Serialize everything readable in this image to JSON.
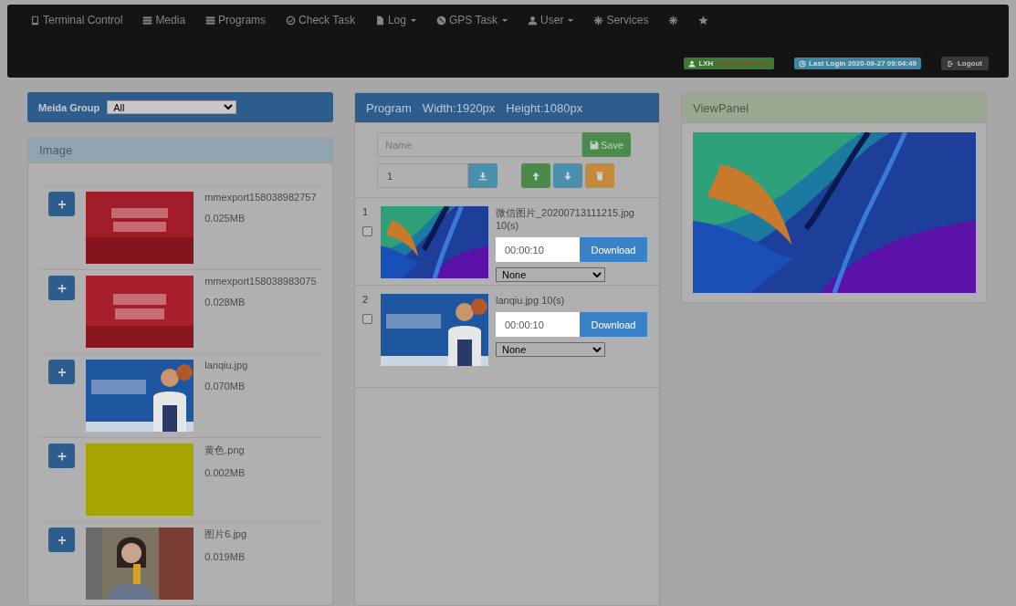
{
  "navbar": {
    "items": [
      {
        "kind": "phone",
        "label": "Terminal Control",
        "dropdown": false
      },
      {
        "kind": "list",
        "label": "Media",
        "dropdown": false
      },
      {
        "kind": "list",
        "label": "Programs",
        "dropdown": false
      },
      {
        "kind": "check",
        "label": "Check Task",
        "dropdown": false
      },
      {
        "kind": "file",
        "label": "Log",
        "dropdown": true
      },
      {
        "kind": "globe",
        "label": "GPS Task",
        "dropdown": true
      },
      {
        "kind": "user",
        "label": "User",
        "dropdown": true
      },
      {
        "kind": "asterisk",
        "label": "Services",
        "dropdown": false
      },
      {
        "kind": "asterisk",
        "dropdown": false
      },
      {
        "kind": "star",
        "dropdown": false
      }
    ],
    "user": {
      "name": "LXH",
      "status": "(Authenticated)"
    },
    "last_login": "Last Login 2020-09-27 09:04:49",
    "logout": "Logout"
  },
  "media_group": {
    "label": "Meida Group",
    "value": "All"
  },
  "image_panel": {
    "title": "Image",
    "items": [
      {
        "name": "mmexport158038982757",
        "size": "0.025MB"
      },
      {
        "name": "mmexport158038983075",
        "size": "0.028MB"
      },
      {
        "name": "lanqiu.jpg",
        "size": "0.070MB"
      },
      {
        "name": "黄色.png",
        "size": "0.002MB"
      },
      {
        "name": "图片6.jpg",
        "size": "0.019MB"
      }
    ]
  },
  "program_panel": {
    "title": "Program",
    "width": "Width:1920px",
    "height": "Height:1080px",
    "name_placeholder": "Name",
    "save": "Save",
    "page": "1",
    "items": [
      {
        "index": "1",
        "checked": false,
        "title": "微信图片_20200713111215.jpg 10(s)",
        "duration": "00:00:10",
        "download": "Download",
        "transition": "None"
      },
      {
        "index": "2",
        "checked": false,
        "title": "lanqiu.jpg 10(s)",
        "duration": "00:00:10",
        "download": "Download",
        "transition": "None"
      }
    ]
  },
  "view_panel": {
    "title": "ViewPanel"
  }
}
